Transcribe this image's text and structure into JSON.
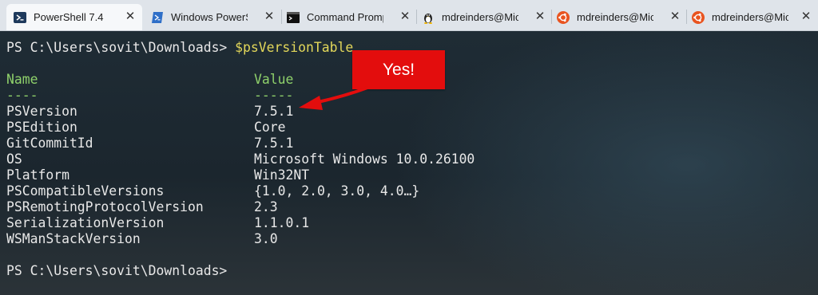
{
  "tabs": [
    {
      "label": "PowerShell 7.4",
      "icon": "powershell-icon",
      "active": true
    },
    {
      "label": "Windows PowerS",
      "icon": "powershell-icon",
      "active": false
    },
    {
      "label": "Command Promp",
      "icon": "cmd-icon",
      "active": false
    },
    {
      "label": "mdreinders@Mic",
      "icon": "linux-tux-icon",
      "active": false
    },
    {
      "label": "mdreinders@Mic",
      "icon": "ubuntu-icon",
      "active": false
    },
    {
      "label": "mdreinders@Mic",
      "icon": "ubuntu-icon",
      "active": false
    }
  ],
  "tab_close_glyph": "✕",
  "terminal": {
    "prompt": "PS C:\\Users\\sovit\\Downloads> ",
    "command": "$psVersionTable",
    "header": {
      "name": "Name",
      "value": "Value",
      "name_rule": "----",
      "value_rule": "-----"
    },
    "rows": [
      {
        "name": "PSVersion",
        "value": "7.5.1"
      },
      {
        "name": "PSEdition",
        "value": "Core"
      },
      {
        "name": "GitCommitId",
        "value": "7.5.1"
      },
      {
        "name": "OS",
        "value": "Microsoft Windows 10.0.26100"
      },
      {
        "name": "Platform",
        "value": "Win32NT"
      },
      {
        "name": "PSCompatibleVersions",
        "value": "{1.0, 2.0, 3.0, 4.0…}"
      },
      {
        "name": "PSRemotingProtocolVersion",
        "value": "2.3"
      },
      {
        "name": "SerializationVersion",
        "value": "1.1.0.1"
      },
      {
        "name": "WSManStackVersion",
        "value": "3.0"
      }
    ],
    "final_prompt": "PS C:\\Users\\sovit\\Downloads>"
  },
  "annotation": {
    "text": "Yes!",
    "color": "#e30d0d"
  },
  "colors": {
    "header": "#8fd16b",
    "command": "#e3d85a",
    "text": "#e8e8e8"
  }
}
